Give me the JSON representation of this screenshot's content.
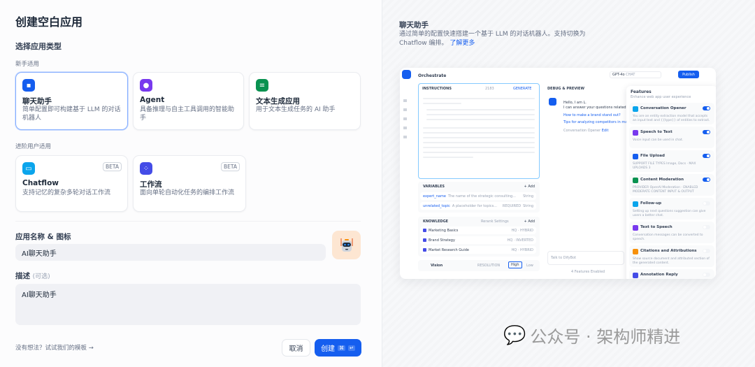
{
  "dialog": {
    "title": "创建空白应用",
    "type_heading": "选择应用类型",
    "beginner_label": "新手适用",
    "advanced_label": "进阶用户适用"
  },
  "app_types": [
    {
      "name": "聊天助手",
      "desc": "简单配置即可构建基于 LLM 的对话机器人",
      "color": "#155eef",
      "selected": true
    },
    {
      "name": "Agent",
      "desc": "具备推理与自主工具调用的智能助手",
      "color": "#7839ee"
    },
    {
      "name": "文本生成应用",
      "desc": "用于文本生成任务的 AI 助手",
      "color": "#099250"
    },
    {
      "name": "Chatflow",
      "desc": "支持记忆的复杂多轮对话工作流",
      "badge": "BETA",
      "color": "#0ba5ec"
    },
    {
      "name": "工作流",
      "desc": "面向单轮自动化任务的编排工作流",
      "badge": "BETA",
      "color": "#444ce7"
    }
  ],
  "form": {
    "name_label": "应用名称 & 图标",
    "name_value": "AI聊天助手",
    "desc_label": "描述",
    "desc_optional": "(可选)",
    "desc_value": "AI聊天助手"
  },
  "footer": {
    "template_link": "没有想法？试试我们的模板",
    "cancel": "取消",
    "create": "创建",
    "shortcut_cmd": "⌘",
    "shortcut_enter": "↵"
  },
  "info": {
    "title": "聊天助手",
    "desc": "通过简单的配置快速搭建一个基于 LLM 的对话机器人。支持切换为 Chatflow 编排。",
    "learn_more": "了解更多"
  },
  "preview": {
    "orchestrate": "Orchestrate",
    "model": "GPT-4o",
    "model_tag": "CHAT",
    "publish": "Publish",
    "instructions": "INSTRUCTIONS",
    "count": "2183",
    "generate": "GENERATE",
    "debug": "DEBUG & PREVIEW",
    "greeting1": "Hello, I am L.",
    "greeting2": "I can answer your questions related",
    "q1": "How to make a brand stand out?",
    "q2": "Tips for analyzing competitors in market",
    "opener": "Conversation Opener",
    "edit": "Edit",
    "variables": "VARIABLES",
    "add": "Add",
    "vars": [
      {
        "name": "expert_name",
        "desc": "The name of the strategic consulting...",
        "type": "String"
      },
      {
        "name": "unrelated_topic",
        "desc": "A placeholder for topics...",
        "req": "REQUIRED",
        "type": "String"
      }
    ],
    "knowledge": "KNOWLEDGE",
    "rerank": "Rerank Settings",
    "docs": [
      {
        "name": "Marketing Basics",
        "tag": "HQ · HYBRID"
      },
      {
        "name": "Brand Strategy",
        "tag": "HQ · INVERTED"
      },
      {
        "name": "Market Research Guide",
        "tag": "HQ · HYBRID"
      }
    ],
    "vision": "Vision",
    "resolution": "RESOLUTION",
    "high": "High",
    "low": "Low",
    "chat_placeholder": "Talk to DifyBot",
    "features_enabled": "4 Features Enabled",
    "features_title": "Features",
    "features_sub": "Enhance web app user experience",
    "features": [
      {
        "name": "Conversation Opener",
        "desc": "You are an entity extraction model that accepts an input text and {{type}} of entities to extract.",
        "on": true,
        "color": "#0ba5ec"
      },
      {
        "name": "Speech to Text",
        "desc": "Voice input can be used in chat.",
        "on": true,
        "color": "#7839ee"
      },
      {
        "name": "File Upload",
        "desc": "SUPPORT FILE TYPES Image, Docs · MAX UPLOADS 3",
        "on": true,
        "color": "#155eef"
      },
      {
        "name": "Content Moderation",
        "desc": "PROVIDER OpenAI Moderation · ENABLED MODERATE CONTENT INPUT & OUTPUT",
        "on": true,
        "color": "#099250"
      },
      {
        "name": "Follow-up",
        "desc": "Setting up next questions suggestion can give users a better chat.",
        "on": false,
        "color": "#0ba5ec"
      },
      {
        "name": "Text to Speech",
        "desc": "Conversation messages can be converted to speech.",
        "on": false,
        "color": "#7839ee"
      },
      {
        "name": "Citations and Attributions",
        "desc": "Show source document and attributed section of the generated content.",
        "on": false,
        "color": "#f79009"
      },
      {
        "name": "Annotation Reply",
        "desc": "",
        "on": false,
        "color": "#444ce7"
      }
    ]
  },
  "watermark": "公众号 · 架构师精进"
}
